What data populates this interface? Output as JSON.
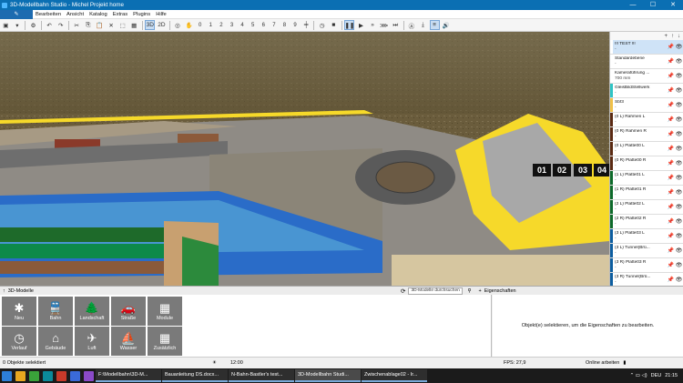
{
  "window": {
    "title": "3D-Modellbahn Studio - Michel Projekt home",
    "min": "—",
    "max": "☐",
    "close": "✕"
  },
  "menu": [
    "Bearbeiten",
    "Ansicht",
    "Katalog",
    "Extras",
    "Plugins",
    "Hilfe"
  ],
  "toolbar": {
    "view3d": "3D",
    "view2d": "2D",
    "numbers": [
      "0",
      "1",
      "2",
      "3",
      "4",
      "5",
      "6",
      "7",
      "8",
      "9"
    ]
  },
  "viewport": {
    "markers": [
      "01",
      "02",
      "03",
      "04"
    ]
  },
  "layers": {
    "header_up": "↑",
    "header_down": "↓",
    "header_add": "+",
    "items": [
      {
        "name": "!!! TEST !!!",
        "sub": "-",
        "color": "#ffffff"
      },
      {
        "name": "Standardebene",
        "sub": "-",
        "color": "#ffffff"
      },
      {
        "name": "Kameraführung ...",
        "sub": "700 mm",
        "color": "#ffffff"
      },
      {
        "name": "GleisBildStellwerk",
        "sub": "-",
        "color": "#2ec4c4"
      },
      {
        "name": "Sbf3",
        "sub": "-",
        "color": "#f0c048"
      },
      {
        "name": "(0 L) Rahmen L",
        "sub": "-",
        "color": "#5a2a12"
      },
      {
        "name": "(0 R) Rahmen R",
        "sub": "-",
        "color": "#5a2a12"
      },
      {
        "name": "(0 L) Platte00 L",
        "sub": "-",
        "color": "#5a2a12"
      },
      {
        "name": "(0 R) Platte00 R",
        "sub": "-",
        "color": "#5a2a12"
      },
      {
        "name": "(1 L) Platte01 L",
        "sub": "-",
        "color": "#0d6a2a"
      },
      {
        "name": "(1 R) Platte01 R",
        "sub": "-",
        "color": "#0d6a2a"
      },
      {
        "name": "(2 L) Platte02 L",
        "sub": "-",
        "color": "#0d6a2a"
      },
      {
        "name": "(2 R) Platte02 R",
        "sub": "-",
        "color": "#0d6a2a"
      },
      {
        "name": "(3 L) Platte03 L",
        "sub": "-",
        "color": "#0d5ea0"
      },
      {
        "name": "(3 L) Tunnel(Brü...",
        "sub": "-",
        "color": "#0d5ea0"
      },
      {
        "name": "(3 R) Platte03 R",
        "sub": "-",
        "color": "#0d5ea0"
      },
      {
        "name": "(3 R) Tunnel(Brü...",
        "sub": "-",
        "color": "#0d5ea0"
      }
    ]
  },
  "bottom": {
    "modules_title": "3D-Modelle",
    "search_placeholder": "3D-Modelle durchsuchen",
    "properties_title": "Eigenschaften",
    "properties_hint": "Objekt(e) selektieren, um die Eigenschaften zu bearbeiten.",
    "modules": [
      {
        "label": "Neu",
        "icon": "✱"
      },
      {
        "label": "Bahn",
        "icon": "🚆"
      },
      {
        "label": "Landschaft",
        "icon": "🌲"
      },
      {
        "label": "Straße",
        "icon": "🚗"
      },
      {
        "label": "Module",
        "icon": "▦"
      },
      {
        "label": "Verlauf",
        "icon": "◷"
      },
      {
        "label": "Gebäude",
        "icon": "⌂"
      },
      {
        "label": "Luft",
        "icon": "✈"
      },
      {
        "label": "Wasser",
        "icon": "⛵"
      },
      {
        "label": "Zusätzlich",
        "icon": "▦"
      }
    ]
  },
  "status": {
    "selection": "0 Objekte selektiert",
    "time": "12:00",
    "fps": "FPS: 27,9",
    "mode": "Online arbeiten"
  },
  "taskbar": {
    "apps": [
      "F:\\Modellbahn\\3D-M...",
      "Bauanleitung DS.docx...",
      "N-Bahn-Bastler's test...",
      "3D-Modellbahn Studi...",
      "Zwischenablage02 - Ir..."
    ],
    "lang": "DEU",
    "clock": "21:15"
  },
  "colors": {
    "accent": "#0b6fb3",
    "module_button": "#7a7a7a",
    "track_yellow": "#f6d92a"
  }
}
